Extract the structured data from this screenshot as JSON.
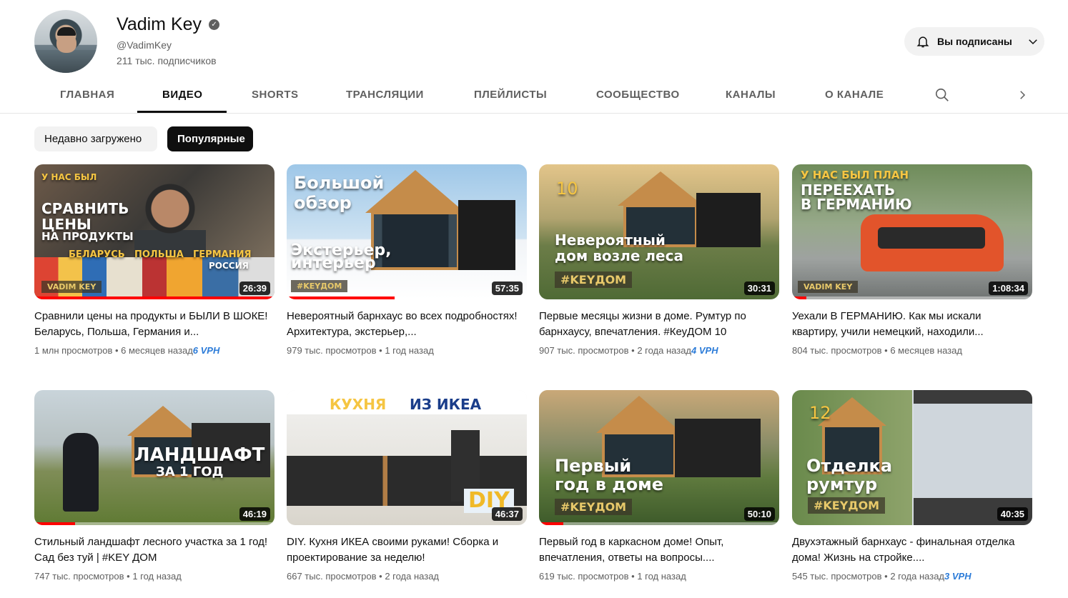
{
  "channel": {
    "name": "Vadim Key",
    "handle": "@VadimKey",
    "subscribers": "211 тыс. подписчиков",
    "subscribe_label": "Вы подписаны"
  },
  "tabs": [
    {
      "label": "ГЛАВНАЯ"
    },
    {
      "label": "ВИДЕО"
    },
    {
      "label": "SHORTS"
    },
    {
      "label": "ТРАНСЛЯЦИИ"
    },
    {
      "label": "ПЛЕЙЛИСТЫ"
    },
    {
      "label": "СООБЩЕСТВО"
    },
    {
      "label": "КАНАЛЫ"
    },
    {
      "label": "О КАНАЛЕ"
    }
  ],
  "filters": {
    "recent": "Недавно загружено",
    "popular": "Популярные"
  },
  "videos": [
    {
      "title": "Сравнили цены на продукты и БЫЛИ В ШОКЕ! Беларусь, Польша, Германия и...",
      "views": "1 млн просмотров",
      "age": "6 месяцев назад",
      "vph": "6 VPH",
      "duration": "26:39",
      "progress": 1.0,
      "overlay": [
        "У НАС БЫЛ",
        "СРАВНИТЬ",
        "ЦЕНЫ",
        "НА ПРОДУКТЫ",
        "БЕЛАРУСЬ",
        "ПОЛЬША",
        "ГЕРМАНИЯ",
        "РОССИЯ",
        "VADIM KEY"
      ]
    },
    {
      "title": "Невероятный барнхаус во всех подробностях! Архитектура, экстерьер,...",
      "views": "979 тыс. просмотров",
      "age": "1 год назад",
      "vph": "",
      "duration": "57:35",
      "progress": 0.45,
      "overlay": [
        "Большой",
        "обзор",
        "Экстерьер,",
        "интерьер",
        "#KEYДОМ"
      ]
    },
    {
      "title": "Первые месяцы жизни в доме. Румтур по барнхаусу, впечатления. #КеуДОМ 10",
      "views": "907 тыс. просмотров",
      "age": "2 года назад",
      "vph": "4 VPH",
      "duration": "30:31",
      "progress": 0.0,
      "overlay": [
        "10",
        "Невероятный",
        "дом возле леса",
        "#KEYДОМ"
      ]
    },
    {
      "title": "Уехали В ГЕРМАНИЮ. Как мы искали квартиру, учили немецкий, находили...",
      "views": "804 тыс. просмотров",
      "age": "6 месяцев назад",
      "vph": "",
      "duration": "1:08:34",
      "progress": 0.06,
      "overlay": [
        "У НАС БЫЛ ПЛАН",
        "ПЕРЕЕХАТЬ",
        "В ГЕРМАНИЮ",
        "VADIM KEY"
      ]
    },
    {
      "title": "Стильный ландшафт лесного участка за 1 год! Сад без туй | #KEY ДОМ",
      "views": "747 тыс. просмотров",
      "age": "1 год назад",
      "vph": "",
      "duration": "46:19",
      "progress": 0.17,
      "overlay": [
        "ЛАНДШАФТ",
        "ЗА 1 ГОД"
      ]
    },
    {
      "title": "DIY. Кухня ИКЕА своими руками! Сборка и проектирование за неделю!",
      "views": "667 тыс. просмотров",
      "age": "2 года назад",
      "vph": "",
      "duration": "46:37",
      "progress": 0.0,
      "overlay": [
        "КУХНЯ",
        "ИЗ ИКЕА",
        "DIY"
      ]
    },
    {
      "title": "Первый год в каркасном доме! Опыт, впечатления, ответы на вопросы....",
      "views": "619 тыс. просмотров",
      "age": "1 год назад",
      "vph": "",
      "duration": "50:10",
      "progress": 0.1,
      "overlay": [
        "Первый",
        "год в доме",
        "#KEYДОМ"
      ]
    },
    {
      "title": "Двухэтажный барнхаус - финальная отделка дома! Жизнь на стройке....",
      "views": "545 тыс. просмотров",
      "age": "2 года назад",
      "vph": "3 VPH",
      "duration": "40:35",
      "progress": 0.0,
      "overlay": [
        "12",
        "Отделка",
        "румтур",
        "#KEYДОМ"
      ]
    }
  ],
  "colors": {
    "accent_red": "#ff0000",
    "vph_blue": "#2b7bd8",
    "text_secondary": "#606060"
  },
  "icons": {
    "bell": "bell-icon",
    "chevron": "chevron-down-icon",
    "search": "search-icon",
    "next": "chevron-right-icon",
    "verified": "verified-icon"
  }
}
